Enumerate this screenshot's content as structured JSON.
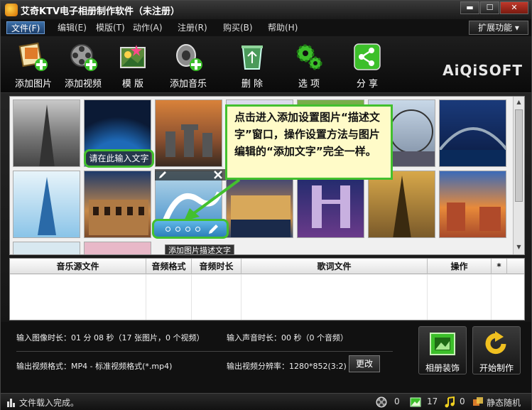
{
  "window": {
    "title": "艾奇KTV电子相册制作软件（未注册）"
  },
  "window_controls": {
    "minimize": "▬",
    "maximize": "☐",
    "close": "✕"
  },
  "menu": {
    "items": [
      "文件(F)",
      "编辑(E)",
      "模版(T)",
      "动作(A)",
      "注册(R)",
      "购买(B)",
      "帮助(H)"
    ],
    "extension": "扩展功能"
  },
  "toolbar": {
    "items": [
      "添加图片",
      "添加视频",
      "模 版",
      "添加音乐",
      "删 除",
      "选 项",
      "分 享"
    ],
    "brand": "AiQiSOFT"
  },
  "gallery": {
    "input_hint": "请在此输入文字",
    "desc_tooltip": "添加图片描述文字",
    "callout": "点击进入添加设置图片“描述文字”窗口，操作设置方法与图片编辑的“添加文字”完全一样。"
  },
  "music_table": {
    "headers": [
      "音乐源文件",
      "音频格式",
      "音频时长",
      "歌词文件",
      "操作",
      "*"
    ]
  },
  "info": {
    "image_duration": "输入图像时长：01 分 08 秒（17 张图片，0 个视频）",
    "audio_duration": "输入声音时长：00 秒（0 个音频）",
    "video_format": "输出视频格式：MP4 - 标准视频格式(*.mp4)",
    "video_resolution": "输出视频分辨率：1280*852(3:2)",
    "change_button": "更改",
    "decorate_button": "相册装饰",
    "start_button": "开始制作"
  },
  "status": {
    "message": "文件载入完成。",
    "video_count": "0",
    "image_count": "17",
    "audio_count": "0",
    "mode": "静态随机"
  }
}
